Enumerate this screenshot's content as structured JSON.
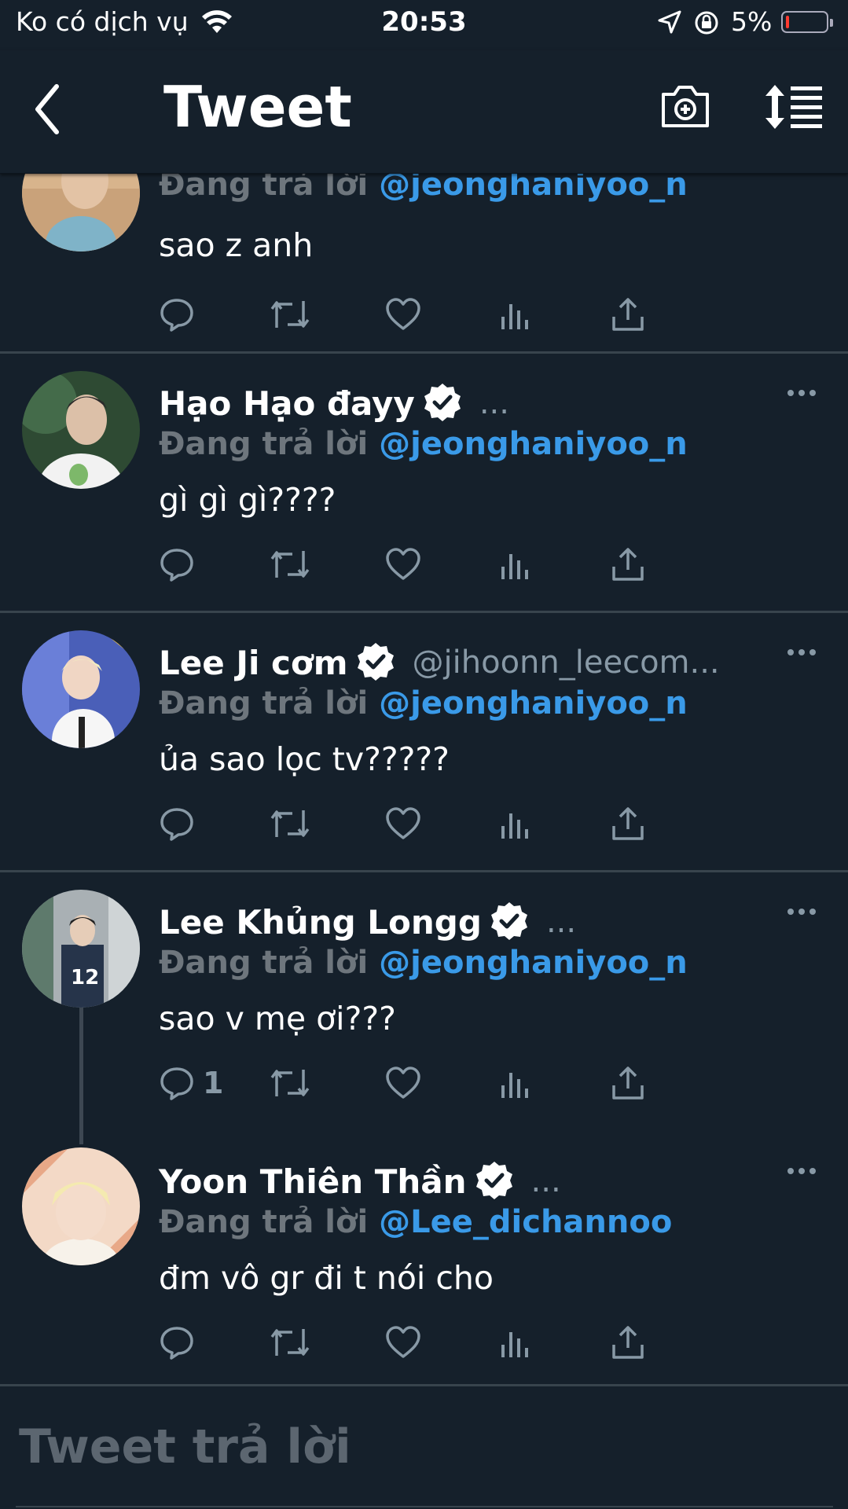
{
  "status_bar": {
    "carrier": "Ko có dịch vụ",
    "time": "20:53",
    "battery_percent": "5%",
    "battery_level": 0.05,
    "icons": [
      "wifi-icon",
      "location-arrow-icon",
      "orientation-lock-icon",
      "battery-icon"
    ]
  },
  "header": {
    "title": "Tweet",
    "icons": [
      "back-chevron-icon",
      "add-photo-camera-icon",
      "sort-replies-icon"
    ]
  },
  "colors": {
    "background": "#15202b",
    "divider": "#38444d",
    "mention": "#3a9ae8",
    "muted": "#6e767d",
    "battery_low": "#ff3b30"
  },
  "replies": [
    {
      "name": "",
      "handle": "",
      "replying_prefix": "Đang trả lời",
      "replying_to": "@jeonghaniyoo_n",
      "text": "sao z anh",
      "reply_count": ""
    },
    {
      "name": "Hạo Hạo đayy",
      "handle": "...",
      "replying_prefix": "Đang trả lời",
      "replying_to": "@jeonghaniyoo_n",
      "text": "gì gì gì????",
      "reply_count": ""
    },
    {
      "name": "Lee Ji cơm",
      "handle": "@jihoonn_leecom...",
      "replying_prefix": "Đang trả lời",
      "replying_to": "@jeonghaniyoo_n",
      "text": "ủa sao lọc tv?????",
      "reply_count": ""
    },
    {
      "name": "Lee Khủng Longg",
      "handle": "...",
      "replying_prefix": "Đang trả lời",
      "replying_to": "@jeonghaniyoo_n",
      "text": "sao v mẹ ơi???",
      "reply_count": "1"
    },
    {
      "name": "Yoon Thiên Thần",
      "handle": "...",
      "replying_prefix": "Đang trả lời",
      "replying_to": "@Lee_dichannoo",
      "text": "đm vô gr đi t nói cho",
      "reply_count": ""
    }
  ],
  "compose": {
    "placeholder": "Tweet trả lời"
  }
}
